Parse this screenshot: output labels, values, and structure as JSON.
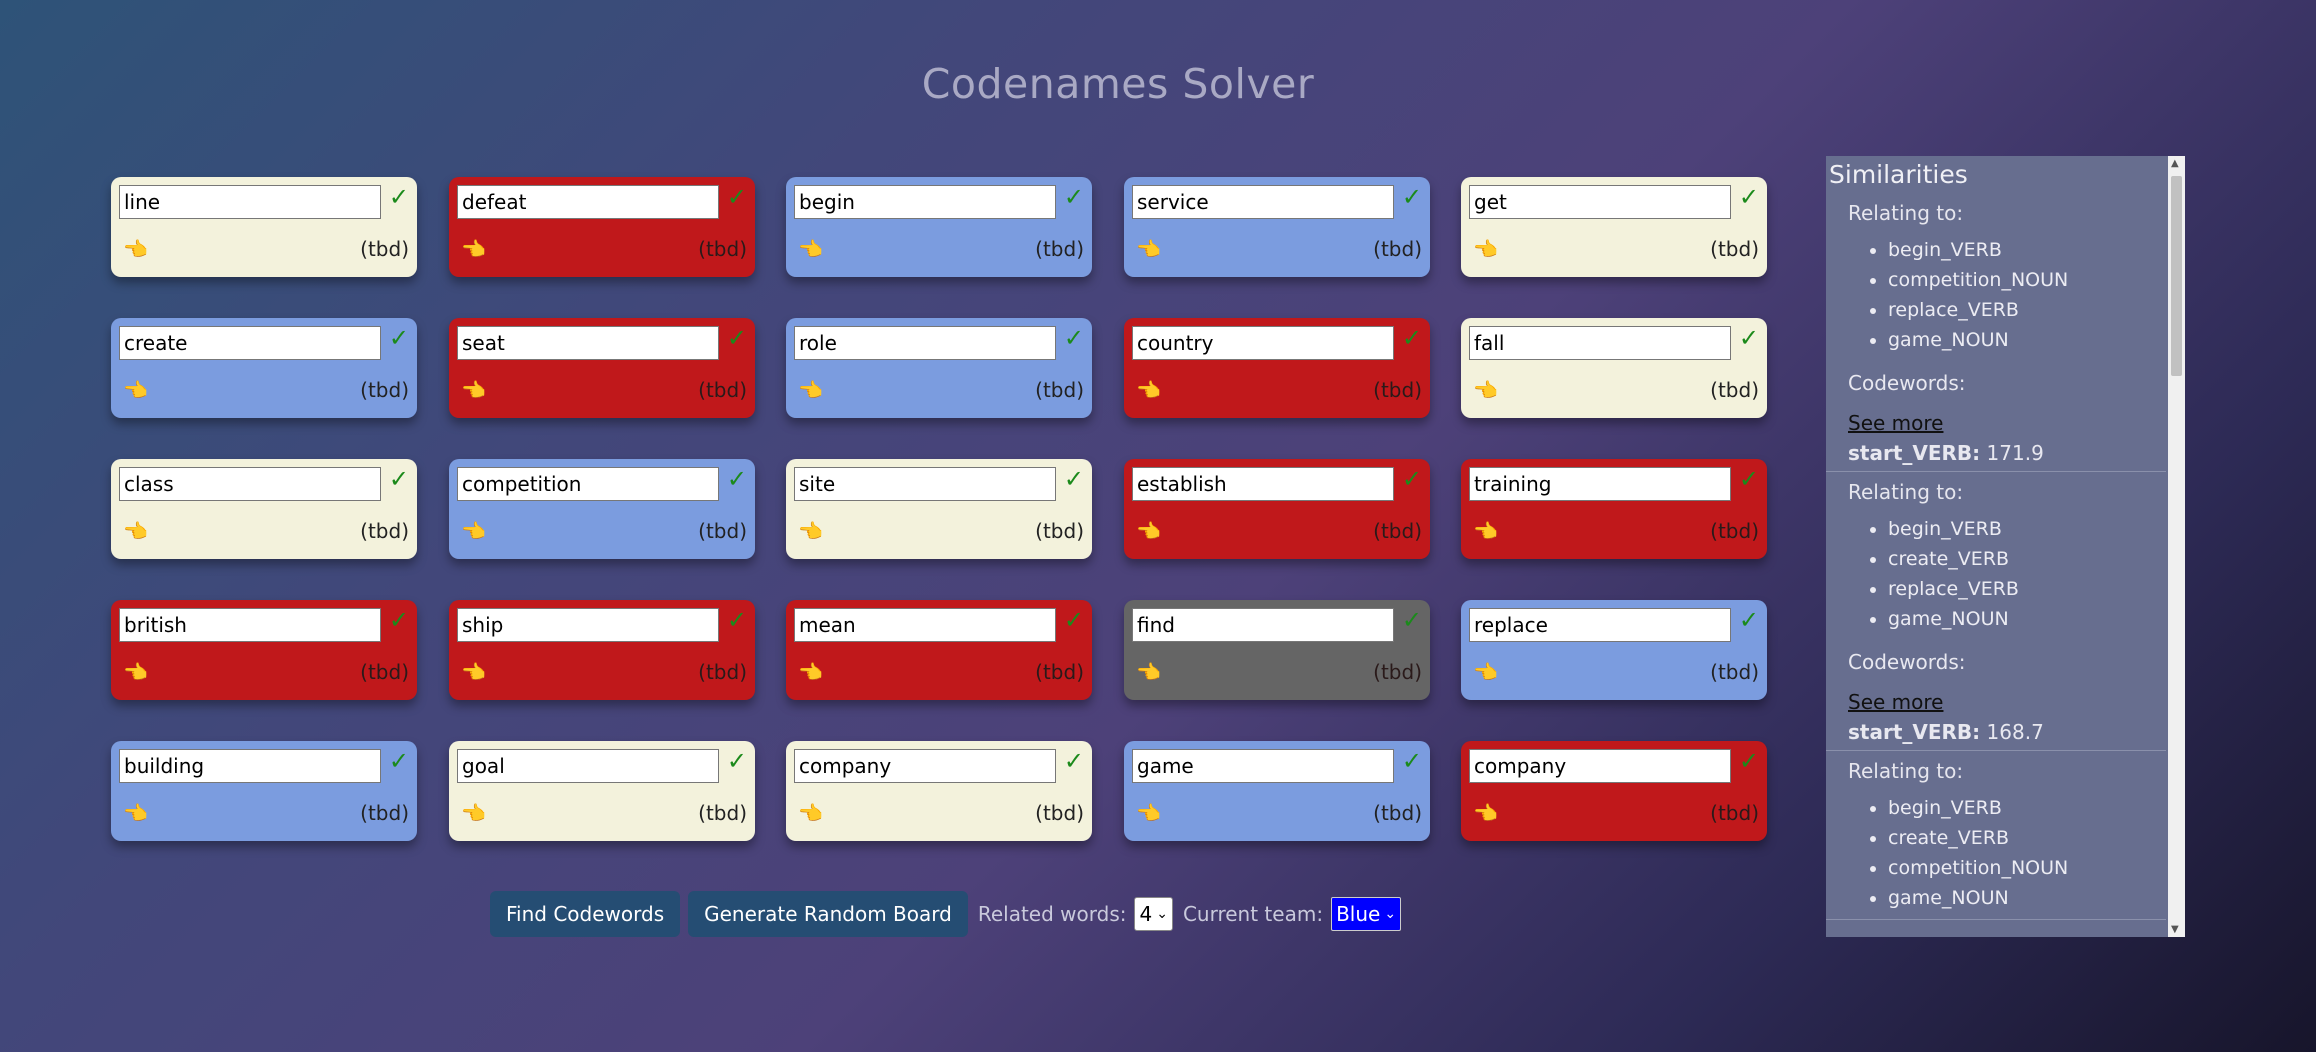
{
  "title": "Codenames Solver",
  "cards": [
    {
      "word": "line",
      "type": "neutral",
      "score": "(tbd)"
    },
    {
      "word": "defeat",
      "type": "red",
      "score": "(tbd)"
    },
    {
      "word": "begin",
      "type": "blue",
      "score": "(tbd)"
    },
    {
      "word": "service",
      "type": "blue",
      "score": "(tbd)"
    },
    {
      "word": "get",
      "type": "neutral",
      "score": "(tbd)"
    },
    {
      "word": "create",
      "type": "blue",
      "score": "(tbd)"
    },
    {
      "word": "seat",
      "type": "red",
      "score": "(tbd)"
    },
    {
      "word": "role",
      "type": "blue",
      "score": "(tbd)"
    },
    {
      "word": "country",
      "type": "red",
      "score": "(tbd)"
    },
    {
      "word": "fall",
      "type": "neutral",
      "score": "(tbd)"
    },
    {
      "word": "class",
      "type": "neutral",
      "score": "(tbd)"
    },
    {
      "word": "competition",
      "type": "blue",
      "score": "(tbd)"
    },
    {
      "word": "site",
      "type": "neutral",
      "score": "(tbd)"
    },
    {
      "word": "establish",
      "type": "red",
      "score": "(tbd)"
    },
    {
      "word": "training",
      "type": "red",
      "score": "(tbd)"
    },
    {
      "word": "british",
      "type": "red",
      "score": "(tbd)"
    },
    {
      "word": "ship",
      "type": "red",
      "score": "(tbd)"
    },
    {
      "word": "mean",
      "type": "red",
      "score": "(tbd)"
    },
    {
      "word": "find",
      "type": "assassin",
      "score": "(tbd)"
    },
    {
      "word": "replace",
      "type": "blue",
      "score": "(tbd)"
    },
    {
      "word": "building",
      "type": "blue",
      "score": "(tbd)"
    },
    {
      "word": "goal",
      "type": "neutral",
      "score": "(tbd)"
    },
    {
      "word": "company",
      "type": "neutral",
      "score": "(tbd)"
    },
    {
      "word": "game",
      "type": "blue",
      "score": "(tbd)"
    },
    {
      "word": "company",
      "type": "red",
      "score": "(tbd)"
    }
  ],
  "colors": {
    "neutral": "#f3f2dc",
    "red": "#c0181b",
    "blue": "#7b9cdf",
    "assassin": "#656565",
    "check": "#1b8a1b",
    "button": "#254d73",
    "team_select": "#0000ff",
    "sidebar": "#676e8f"
  },
  "icons": {
    "check": "check-icon",
    "hand": "pointing-hand-icon"
  },
  "controls": {
    "find_label": "Find Codewords",
    "random_label": "Generate Random Board",
    "related_label": "Related words:",
    "related_value": "4",
    "team_label": "Current team:",
    "team_value": "Blue"
  },
  "sidebar": {
    "title": "Similarities",
    "relating_label": "Relating to:",
    "codewords_label": "Codewords:",
    "see_more_label": "See more",
    "entries": [
      {
        "related": [
          "begin_VERB",
          "competition_NOUN",
          "replace_VERB",
          "game_NOUN"
        ],
        "word": "start_VERB:",
        "score": "171.9"
      },
      {
        "related": [
          "begin_VERB",
          "create_VERB",
          "replace_VERB",
          "game_NOUN"
        ],
        "word": "start_VERB:",
        "score": "168.7"
      },
      {
        "related": [
          "begin_VERB",
          "create_VERB",
          "competition_NOUN",
          "game_NOUN"
        ],
        "word": "",
        "score": ""
      }
    ]
  }
}
